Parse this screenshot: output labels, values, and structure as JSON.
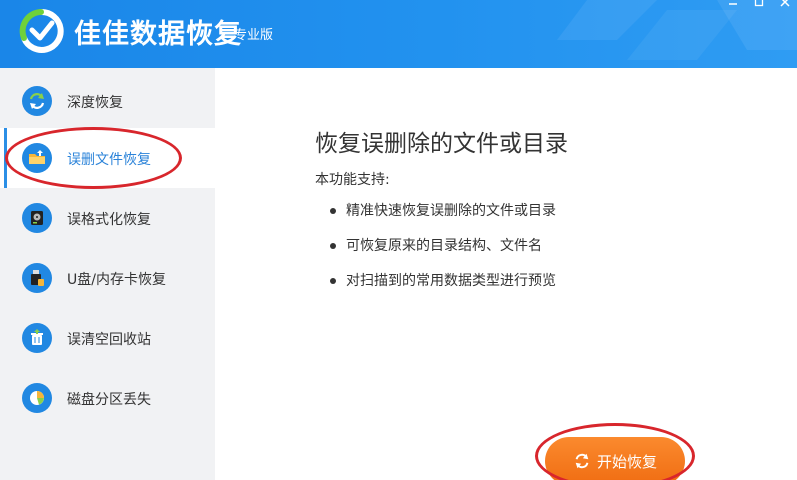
{
  "titlebar": {
    "app_title": "佳佳数据恢复",
    "edition": "专业版",
    "brand_color": "#1e8ceb",
    "controls": [
      "minimize-icon",
      "maximize-icon",
      "close-icon"
    ]
  },
  "sidebar": {
    "items": [
      {
        "label": "深度恢复",
        "icon": "refresh-circle-icon",
        "active": false
      },
      {
        "label": "误删文件恢复",
        "icon": "folder-upload-icon",
        "active": true
      },
      {
        "label": "误格式化恢复",
        "icon": "hard-disk-icon",
        "active": false
      },
      {
        "label": "U盘/内存卡恢复",
        "icon": "usb-drive-icon",
        "active": false
      },
      {
        "label": "误清空回收站",
        "icon": "recycle-bin-icon",
        "active": false
      },
      {
        "label": "磁盘分区丢失",
        "icon": "pie-chart-icon",
        "active": false
      }
    ]
  },
  "main": {
    "title": "恢复误删除的文件或目录",
    "subtitle": "本功能支持:",
    "features": [
      "精准快速恢复误删除的文件或目录",
      "可恢复原来的目录结构、文件名",
      "对扫描到的常用数据类型进行预览"
    ],
    "start_button": "开始恢复",
    "accent_color": "#f47a1f"
  }
}
